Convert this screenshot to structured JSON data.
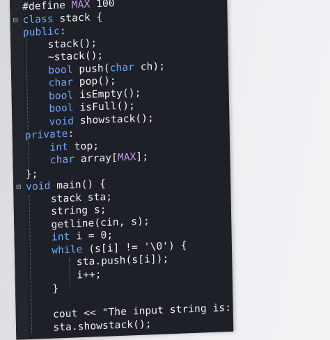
{
  "editor": {
    "lines": [
      {
        "indent": "",
        "parts": [
          {
            "t": "#define ",
            "c": ""
          },
          {
            "t": "MAX",
            "c": "macro"
          },
          {
            "t": " 100",
            "c": ""
          }
        ]
      },
      {
        "indent": "",
        "parts": [
          {
            "t": "class",
            "c": "kw"
          },
          {
            "t": " stack {",
            "c": ""
          }
        ]
      },
      {
        "indent": "",
        "parts": [
          {
            "t": "public",
            "c": "kw"
          },
          {
            "t": ":",
            "c": ""
          }
        ]
      },
      {
        "indent": "    ",
        "parts": [
          {
            "t": "stack();",
            "c": ""
          }
        ]
      },
      {
        "indent": "    ",
        "parts": [
          {
            "t": "~stack();",
            "c": ""
          }
        ]
      },
      {
        "indent": "    ",
        "parts": [
          {
            "t": "bool",
            "c": "kw"
          },
          {
            "t": " push(",
            "c": ""
          },
          {
            "t": "char",
            "c": "kw"
          },
          {
            "t": " ch);",
            "c": ""
          }
        ]
      },
      {
        "indent": "    ",
        "parts": [
          {
            "t": "char",
            "c": "kw"
          },
          {
            "t": " pop();",
            "c": ""
          }
        ]
      },
      {
        "indent": "    ",
        "parts": [
          {
            "t": "bool",
            "c": "kw"
          },
          {
            "t": " isEmpty();",
            "c": ""
          }
        ]
      },
      {
        "indent": "    ",
        "parts": [
          {
            "t": "bool",
            "c": "kw"
          },
          {
            "t": " isFull();",
            "c": ""
          }
        ]
      },
      {
        "indent": "    ",
        "parts": [
          {
            "t": "void",
            "c": "kw"
          },
          {
            "t": " showstack();",
            "c": ""
          }
        ]
      },
      {
        "indent": "",
        "parts": [
          {
            "t": "private",
            "c": "kw"
          },
          {
            "t": ":",
            "c": ""
          }
        ]
      },
      {
        "indent": "    ",
        "parts": [
          {
            "t": "int",
            "c": "kw"
          },
          {
            "t": " top;",
            "c": ""
          }
        ]
      },
      {
        "indent": "    ",
        "parts": [
          {
            "t": "char",
            "c": "kw"
          },
          {
            "t": " array[",
            "c": ""
          },
          {
            "t": "MAX",
            "c": "macro"
          },
          {
            "t": "];",
            "c": ""
          }
        ]
      },
      {
        "indent": "",
        "parts": [
          {
            "t": "};",
            "c": ""
          }
        ]
      },
      {
        "indent": "",
        "parts": [
          {
            "t": "void",
            "c": "kw"
          },
          {
            "t": " main() {",
            "c": ""
          }
        ]
      },
      {
        "indent": "    ",
        "parts": [
          {
            "t": "stack sta;",
            "c": ""
          }
        ]
      },
      {
        "indent": "    ",
        "parts": [
          {
            "t": "string s;",
            "c": ""
          }
        ]
      },
      {
        "indent": "    ",
        "parts": [
          {
            "t": "getline(cin, s);",
            "c": ""
          }
        ]
      },
      {
        "indent": "    ",
        "parts": [
          {
            "t": "int",
            "c": "kw"
          },
          {
            "t": " i = 0;",
            "c": ""
          }
        ]
      },
      {
        "indent": "    ",
        "parts": [
          {
            "t": "while",
            "c": "kw"
          },
          {
            "t": " (s[i] != '\\0') {",
            "c": ""
          }
        ]
      },
      {
        "indent": "        ",
        "parts": [
          {
            "t": "sta.push(s[i]);",
            "c": ""
          }
        ]
      },
      {
        "indent": "        ",
        "parts": [
          {
            "t": "i++;",
            "c": ""
          }
        ]
      },
      {
        "indent": "    ",
        "parts": [
          {
            "t": "}",
            "c": ""
          }
        ]
      },
      {
        "indent": "",
        "parts": [
          {
            "t": "",
            "c": ""
          }
        ]
      },
      {
        "indent": "    ",
        "parts": [
          {
            "t": "cout << \"The input string is: \";",
            "c": ""
          }
        ]
      },
      {
        "indent": "    ",
        "parts": [
          {
            "t": "sta.showstack();",
            "c": ""
          }
        ]
      }
    ],
    "fold_markers": [
      "⊟",
      "⊟"
    ]
  }
}
